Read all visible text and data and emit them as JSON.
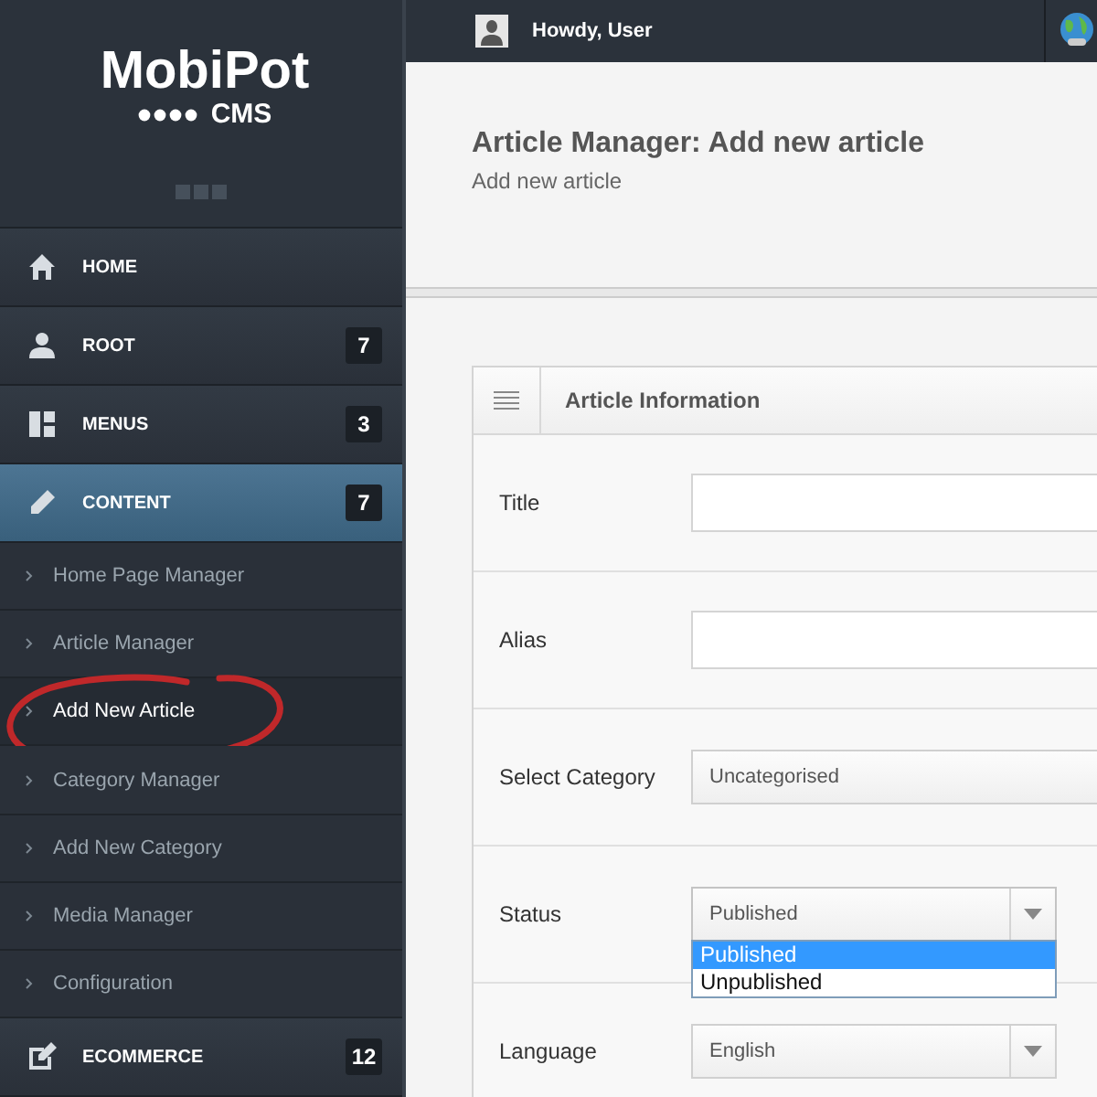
{
  "topbar": {
    "greeting": "Howdy, User"
  },
  "sidebar": {
    "logo": {
      "name": "MobiPot",
      "sub": "CMS"
    },
    "items": [
      {
        "kind": "section",
        "label": "HOME",
        "selected": false
      },
      {
        "kind": "section",
        "label": "ROOT",
        "badge": "7",
        "selected": false
      },
      {
        "kind": "section",
        "label": "MENUS",
        "badge": "3",
        "selected": false
      },
      {
        "kind": "section",
        "label": "CONTENT",
        "badge": "7",
        "selected": true
      },
      {
        "kind": "sub",
        "label": "Home Page Manager",
        "selected": false,
        "circled": false
      },
      {
        "kind": "sub",
        "label": "Article Manager",
        "selected": false,
        "circled": false
      },
      {
        "kind": "sub",
        "label": "Add New Article",
        "selected": true,
        "circled": true
      },
      {
        "kind": "sub",
        "label": "Category Manager",
        "selected": false,
        "circled": false
      },
      {
        "kind": "sub",
        "label": "Add New Category",
        "selected": false,
        "circled": false
      },
      {
        "kind": "sub",
        "label": "Media Manager",
        "selected": false,
        "circled": false
      },
      {
        "kind": "sub",
        "label": "Configuration",
        "selected": false,
        "circled": false
      },
      {
        "kind": "section",
        "label": "ECOMMERCE",
        "badge": "12",
        "selected": false
      }
    ]
  },
  "page": {
    "title": "Article Manager: Add new article",
    "subtitle": "Add new article"
  },
  "card": {
    "title": "Article Information",
    "fields": [
      {
        "kind": "text",
        "label": "Title"
      },
      {
        "kind": "text",
        "label": "Alias"
      },
      {
        "kind": "select",
        "label": "Select Category",
        "value": "Uncategorised",
        "wide": true
      },
      {
        "kind": "select",
        "label": "Status",
        "value": "Published",
        "wide": false,
        "open": true,
        "options": [
          {
            "label": "Published",
            "selected": true
          },
          {
            "label": "Unpublished",
            "selected": false
          }
        ]
      },
      {
        "kind": "select",
        "label": "Language",
        "value": "English",
        "wide": false
      }
    ]
  }
}
